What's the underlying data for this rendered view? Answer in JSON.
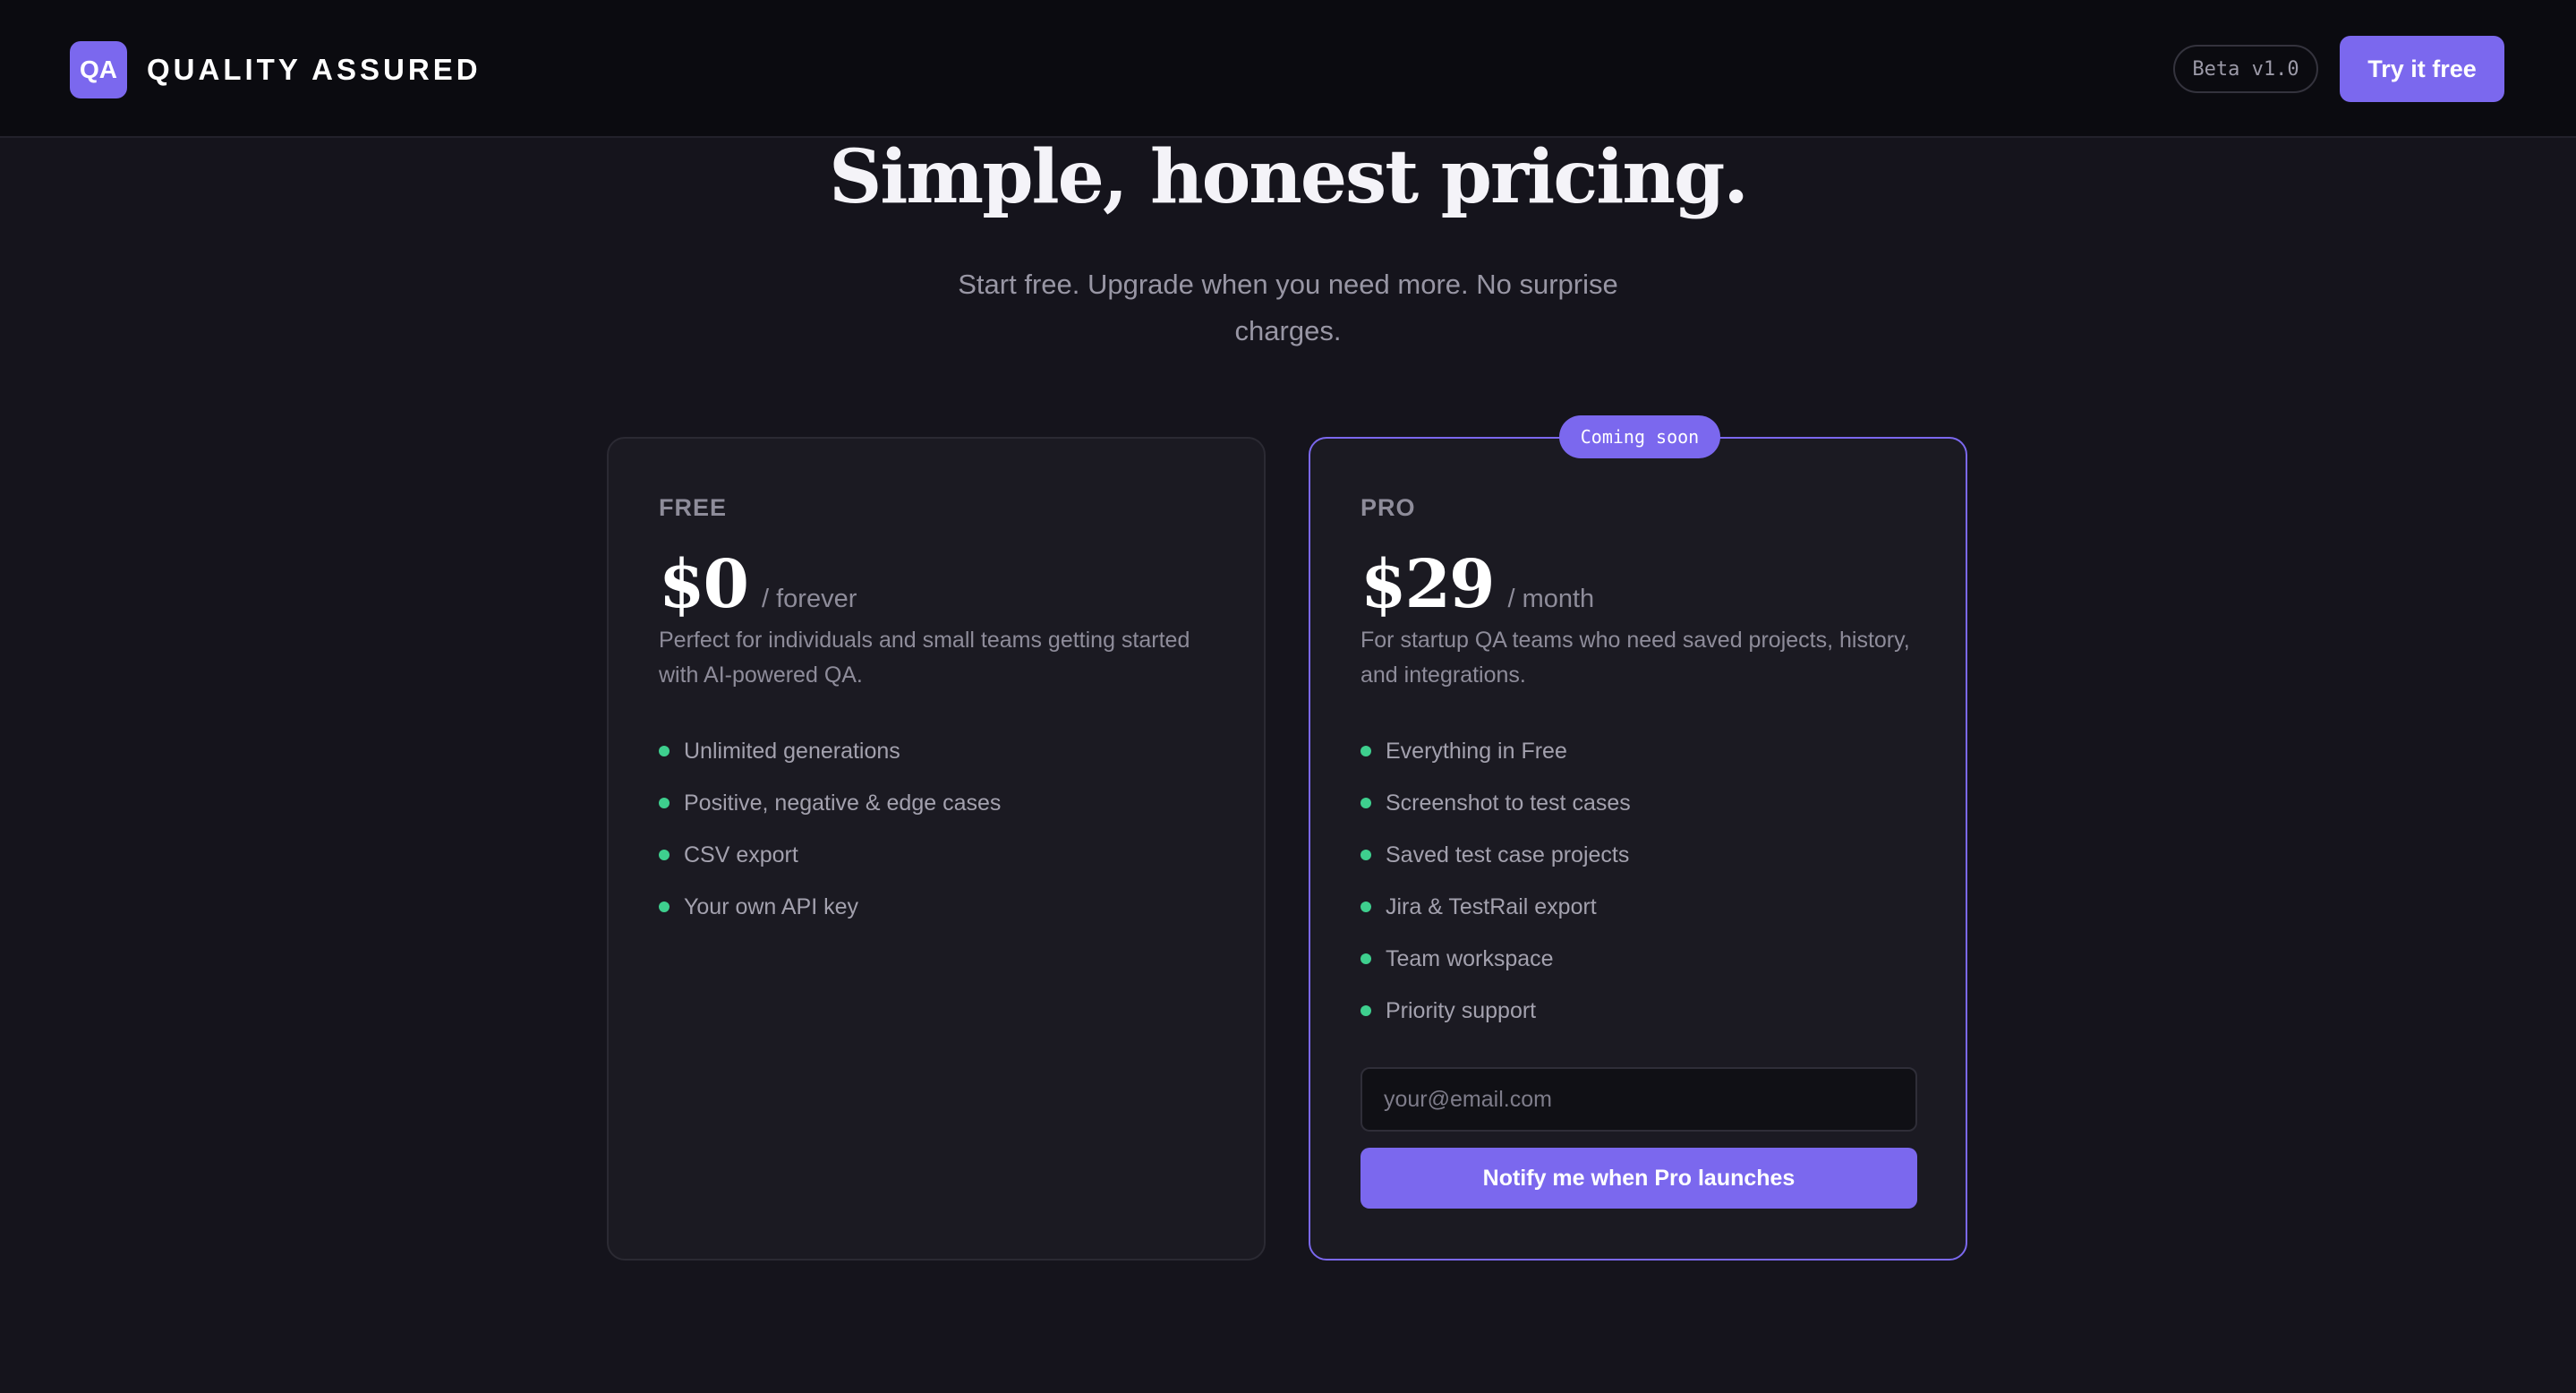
{
  "header": {
    "logo_text": "QA",
    "brand": "QUALITY ASSURED",
    "beta_label": "Beta v1.0",
    "cta_label": "Try it free"
  },
  "hero": {
    "title": "Simple, honest pricing.",
    "subtitle": "Start free. Upgrade when you need more. No surprise charges."
  },
  "plans": [
    {
      "name": "FREE",
      "price": "$0",
      "period": "/ forever",
      "description": "Perfect for individuals and small teams getting started with AI-powered QA.",
      "features": [
        "Unlimited generations",
        "Positive, negative & edge cases",
        "CSV export",
        "Your own API key"
      ]
    },
    {
      "name": "PRO",
      "badge": "Coming soon",
      "price": "$29",
      "period": "/ month",
      "description": "For startup QA teams who need saved projects, history, and integrations.",
      "features": [
        "Everything in Free",
        "Screenshot to test cases",
        "Saved test case projects",
        "Jira & TestRail export",
        "Team workspace",
        "Priority support"
      ],
      "email_placeholder": "your@email.com",
      "notify_label": "Notify me when Pro launches"
    }
  ],
  "colors": {
    "accent": "#7b68ee",
    "feature_dot": "#3ecf8e",
    "background": "#15141c",
    "header_bg": "#0b0b10"
  }
}
